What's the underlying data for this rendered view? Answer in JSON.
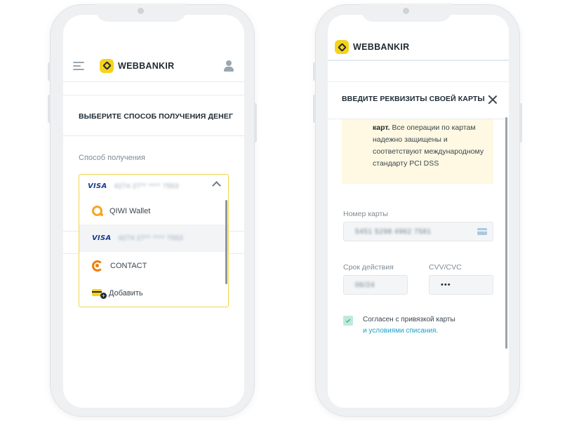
{
  "left_screen": {
    "brand": "WEBBANKIR",
    "section_title": "ВЫБЕРИТЕ СПОСОБ ПОЛУЧЕНИЯ ДЕНЕГ",
    "method_label": "Способ получения",
    "selected": {
      "card_brand": "VISA",
      "card_masked": "4274 27** **** 7553"
    },
    "dropdown": [
      {
        "icon": "qiwi-icon",
        "label": "QIWI Wallet"
      },
      {
        "icon": "visa-logo",
        "label": "VISA",
        "masked": "4274 27** **** 7553"
      },
      {
        "icon": "contact-icon",
        "label": "CONTACT"
      },
      {
        "icon": "add-card-icon",
        "label": "Добавить"
      }
    ]
  },
  "right_screen": {
    "brand": "WEBBANKIR",
    "modal_title": "ВВЕДИТЕ РЕКВИЗИТЫ СВОЕЙ КАРТЫ",
    "info": {
      "bold": "карт.",
      "text": "Все операции по картам надежно защищены и соответствуют международному стандарту PCI DSS"
    },
    "card_number": {
      "label": "Номер карты",
      "value": "5451 5298 4962 7581"
    },
    "expiry": {
      "label": "Срок действия",
      "value": "06/24"
    },
    "cvv": {
      "label": "CVV/CVC",
      "value": "•••"
    },
    "agree": {
      "text": "Согласен с привязкой карты",
      "link": "и условиями списания.",
      "checked": true
    }
  }
}
